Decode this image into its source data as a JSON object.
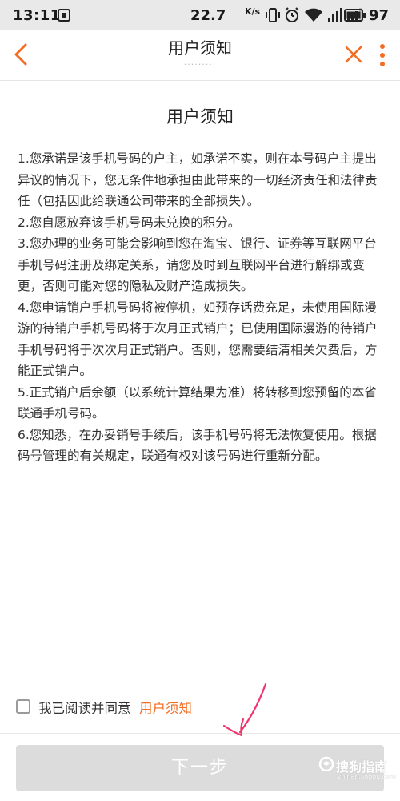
{
  "status_bar": {
    "time": "13:11",
    "net_speed": "22.7",
    "net_speed_unit": "K/s",
    "battery": "97"
  },
  "header": {
    "title": "用户须知",
    "subtitle": "·········"
  },
  "content": {
    "heading": "用户须知",
    "terms": [
      "1.您承诺是该手机号码的户主，如承诺不实，则在本号码户主提出异议的情况下，您无条件地承担由此带来的一切经济责任和法律责任（包括因此给联通公司带来的全部损失）。",
      "2.您自愿放弃该手机号码未兑换的积分。",
      "3.您办理的业务可能会影响到您在淘宝、银行、证券等互联网平台手机号码注册及绑定关系，请您及时到互联网平台进行解绑或变更，否则可能对您的隐私及财产造成损失。",
      "4.您申请销户手机号码将被停机，如预存话费充足，未使用国际漫游的待销户手机号码将于次月正式销户；已使用国际漫游的待销户手机号码将于次次月正式销户。否则，您需要结清相关欠费后，方能正式销户。",
      "5.正式销户后余额（以系统计算结果为准）将转移到您预留的本省联通手机号码。",
      "6.您知悉，在办妥销号手续后，该手机号码将无法恢复使用。根据码号管理的有关规定，联通有权对该号码进行重新分配。"
    ]
  },
  "agreement": {
    "label": "我已阅读并同意",
    "link": "用户须知",
    "checked": false
  },
  "next_button": {
    "label": "下一步"
  },
  "watermark": {
    "text": "搜狗指南",
    "sub": "zhinan.sogou.com"
  },
  "colors": {
    "accent": "#f36c21",
    "button_disabled": "#dcdcdc",
    "annotation_arrow": "#f0346e"
  },
  "icons": {
    "back": "chevron-left-icon",
    "close": "close-icon",
    "more": "more-vertical-icon"
  }
}
